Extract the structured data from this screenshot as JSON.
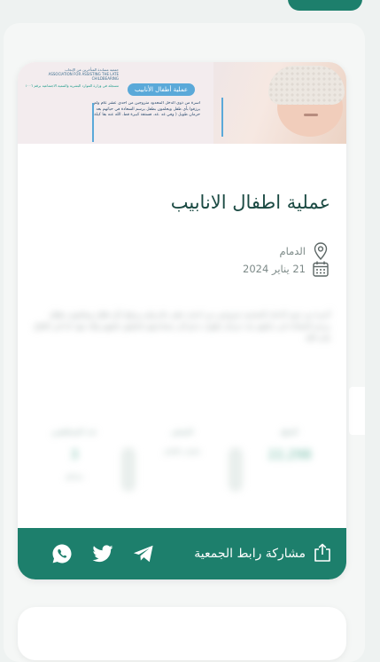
{
  "banner": {
    "org_name": "جمعية مساندة المتأخرين عن الإنجاب",
    "org_name_en": "ASSOCIATION FOR ASSISTING THE LATE CHILDBEARING",
    "org_sub": "مسجلة في وزارة الموارد البشرية والتنمية الاجتماعية برقم ١٠٠٦",
    "pill_label": "عملية أطفال الأنابيب",
    "text": "أسرة من ذوي الدخل المحدود متزوجين من احدى عشر عام ولم يرزقوا بأي طفل ويحلمون بطفل يرسم السعادة في حياتهم بعد حرمان طويل ( وفي غد  .غد. فستقة كبيرة قط. الله عنه بقا كيلة"
  },
  "card": {
    "title": "عملية اطفال الانابيب",
    "location": "الدمام",
    "date": "21 يناير 2024",
    "description": "أسرة من ذوي الدخل المحدود متزوجين من احدى عشر عام ولم يرزقوا بأي طفل ويحلمون بطفل يرسم السعادة في حياتهم بعد حرمان طويل ندعو الى مساندتهم لتحقيق حلمهم ولله جهد ابنا في العلاج بإذن الله",
    "stats": [
      {
        "label": "المبلغ",
        "value": "22,298",
        "sub": ""
      },
      {
        "label": "المتبقي",
        "value": "",
        "sub": "مكتمل بالكامل"
      },
      {
        "label": "عدد المساهمين",
        "value": "3",
        "sub": "مساهم"
      }
    ]
  },
  "share": {
    "label": "مشاركة رابط الجمعية"
  },
  "icons": {
    "location": "location-pin-icon",
    "calendar": "calendar-icon",
    "share": "share-icon",
    "telegram": "telegram-icon",
    "twitter": "twitter-icon",
    "whatsapp": "whatsapp-icon"
  },
  "colors": {
    "accent": "#1d7f6c",
    "title": "#1b4a43"
  }
}
